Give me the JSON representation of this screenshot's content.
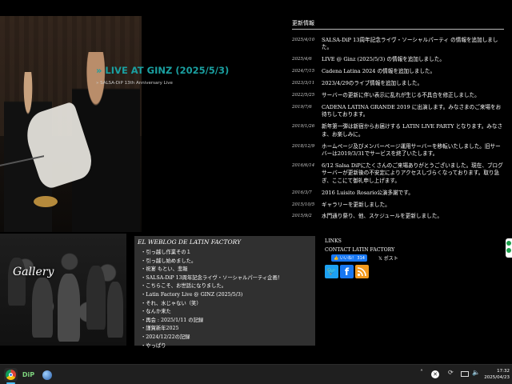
{
  "hero": {
    "title": "» LIVE AT GINZ (2025/5/3)",
    "subtitle": "» SALSA-DiP 13th Anniversary Live"
  },
  "news": {
    "heading": "更新情報",
    "items": [
      {
        "date": "2025/4/10",
        "text": "SALSA-DiP 13周年記念ライヴ・ソーシャルパーティ の情報を追加しました。"
      },
      {
        "date": "2025/4/6",
        "text": "LIVE @ Ginz (2025/5/3) の情報を追加しました。"
      },
      {
        "date": "2024/7/15",
        "text": "Cadena Latina 2024 の情報を追加しました。"
      },
      {
        "date": "2023/3/11",
        "text": "2023/4/29のライブ情報を追加しました。"
      },
      {
        "date": "2022/5/25",
        "text": "サーバーの更新に伴い表示に乱れが生じる不具合を修正しました。"
      },
      {
        "date": "2019/7/6",
        "text": "CADENA LATINA GRANDE 2019 に出演します。みなさまのご来場をお待ちしております。"
      },
      {
        "date": "2019/1/26",
        "text": "新年第一弾は新宿からお届けする LATIN LIVE PARTY となります。みなさま、お楽しみに。"
      },
      {
        "date": "2018/12/9",
        "text": "ホームページ及びメンバーページ運用サーバーを移転いたしました。旧サーバーは2019/3/31でサービスを終了いたします。"
      },
      {
        "date": "2016/6/14",
        "text": "6/12 Salsa DiPにたくさんのご来場ありがとうございました。現在、ブログサーバーが更新後の不安定によりアクセスしづらくなっております。取り急ぎ、ここにて御礼申し上げます。"
      },
      {
        "date": "2016/3/7",
        "text": "2016 Luisito Rosario公演多謝です。"
      },
      {
        "date": "2015/10/5",
        "text": "ギャラリーを更新しました。"
      },
      {
        "date": "2015/9/2",
        "text": "水門通り祭り、他、スケジュールを更新しました。"
      }
    ]
  },
  "gallery": {
    "label": "Gallery"
  },
  "weblog": {
    "title": "EL WEBLOG DE LATIN FACTORY",
    "items": [
      "・引っ越し作業その１",
      "・引っ越し始めました。",
      "・祝宴 もとい、悲報",
      "・SALSA-DiP 13周年記念ライヴ・ソーシャルパーティ企画！",
      "・こちらこそ、お世話になりました。",
      "・Latin Factory Live @ GINZ (2025/5/3)",
      "・それ、水じゃない（笑）",
      "・なんか来た",
      "・再会 : 2025/1/11 の記録",
      "・謹賀新年2025",
      "・2024/12/22の記録",
      "・やっぱり"
    ]
  },
  "links": {
    "heading": "LINKS",
    "contact": "CONTACT LATIN FACTORY",
    "like_label": "👍 いいね！ 314",
    "post_label": "𝕏 ポスト",
    "social_icons": [
      "twitter-icon",
      "facebook-icon",
      "rss-icon"
    ]
  },
  "taskbar": {
    "app2_label": "DiP",
    "time": "17:32",
    "date": "2025/04/23"
  },
  "colors": {
    "accent": "#1a9fa0",
    "weblog_bg": "#303030",
    "background": "#000000",
    "taskbar": "#1f1f1f"
  }
}
